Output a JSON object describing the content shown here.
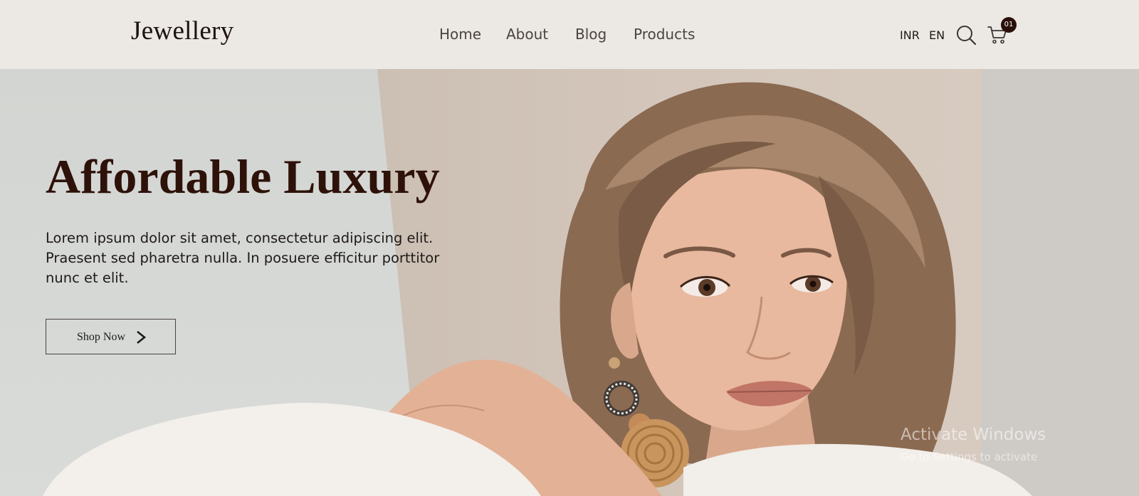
{
  "header": {
    "logo": "Jewellery",
    "nav": [
      "Home",
      "About",
      "Blog",
      "Products"
    ],
    "currency": "INR",
    "language": "EN",
    "search_icon": "search-icon",
    "cart_icon": "cart-icon",
    "cart_count": "01"
  },
  "hero": {
    "title": "Affordable Luxury",
    "description": "Lorem ipsum dolor sit amet, consectetur adipiscing elit. Praesent sed pharetra nulla. In posuere efficitur porttitor nunc et elit.",
    "cta_label": "Shop Now",
    "cta_icon": "chevron-right-icon",
    "image": "model-portrait-with-earrings"
  },
  "watermark": {
    "line1": "Activate Windows",
    "line2": "Go to Settings to activate"
  },
  "colors": {
    "header_bg": "#ece8e4",
    "title": "#2e1209",
    "badge": "#2a0f08"
  }
}
